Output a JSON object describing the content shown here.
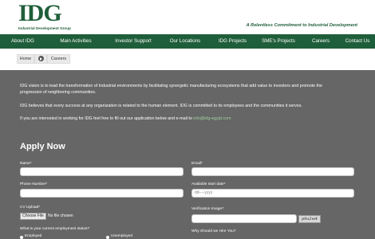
{
  "header": {
    "logo_letters": "IDG",
    "logo_subtitle": "Industrial Development Group",
    "tagline": "A Relentless Commitment to Industrial Development"
  },
  "nav": {
    "items": [
      "About IDG",
      "Main Activities",
      "Investor Support",
      "Our Locations",
      "IDG Projects",
      "SME's Projects",
      "Careers",
      "Contact Us"
    ]
  },
  "breadcrumb": {
    "home": "Home",
    "current": "Careers"
  },
  "content": {
    "para1": "IDG vision is to lead the transformation of Industrial environments by facilitating synergetic manufacturing ecosystems that add value to investors and promote the progression of neighboring communities.",
    "para2": "IDG believes that every success at any organization is related to the human element.  IDG is committed to its employees and the communities it serves.",
    "para3": "If you are interested in working for IDG feel free to fill out our application below and e-mail to",
    "email": "info@idg-egypt.com"
  },
  "form": {
    "title": "Apply Now",
    "name_label": "Name*",
    "email_label": "Email*",
    "phone_label": "Phone Number*",
    "start_date_label": "Available start date*",
    "start_date_placeholder": "dd----yyyy",
    "cv_label": "CV Upload*",
    "file_button": "Choose File",
    "file_status": "No file chosen",
    "verification_label": "Verification Image*:",
    "captcha_text": "p9a2w4",
    "employment_label": "What is your current employment status?",
    "option_employed": "Employed",
    "option_unemployed": "Unemployed",
    "hire_label": "Why Should we Hire You?"
  }
}
